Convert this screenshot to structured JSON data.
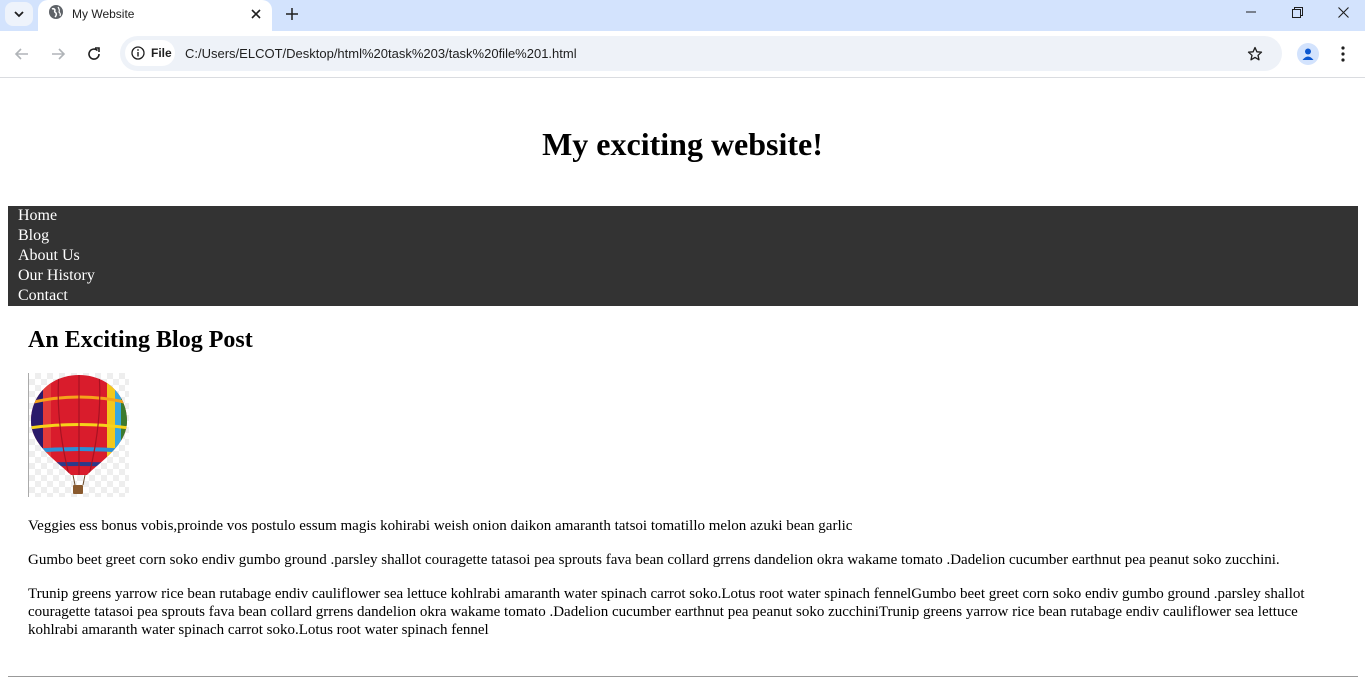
{
  "browser": {
    "tab_title": "My Website",
    "site_chip_label": "File",
    "url": "C:/Users/ELCOT/Desktop/html%20task%203/task%20file%201.html"
  },
  "page": {
    "site_title": "My exciting website!",
    "nav": [
      {
        "label": "Home"
      },
      {
        "label": "Blog"
      },
      {
        "label": "About Us"
      },
      {
        "label": "Our History"
      },
      {
        "label": "Contact"
      }
    ],
    "post_title": "An Exciting Blog Post",
    "paragraphs": [
      "Veggies ess bonus vobis,proinde vos postulo essum magis kohirabi weish onion daikon amaranth tatsoi tomatillo melon azuki bean garlic",
      "Gumbo beet greet corn soko endiv gumbo ground .parsley shallot couragette tatasoi pea sprouts fava bean collard grrens dandelion okra wakame tomato .Dadelion cucumber earthnut pea peanut soko zucchini.",
      "Trunip greens yarrow rice bean rutabage endiv cauliflower sea lettuce kohlrabi amaranth water spinach carrot soko.Lotus root water spinach fennelGumbo beet greet corn soko endiv gumbo ground .parsley shallot couragette tatasoi pea sprouts fava bean collard grrens dandelion okra wakame tomato .Dadelion cucumber earthnut pea peanut soko zucchiniTrunip greens yarrow rice bean rutabage endiv cauliflower sea lettuce kohlrabi amaranth water spinach carrot soko.Lotus root water spinach fennel"
    ]
  },
  "colors": {
    "tab_strip": "#d3e3fd",
    "nav_background": "#333333",
    "nav_text": "#ffffff"
  },
  "icons": {
    "tab_favicon": "globe-icon",
    "tab_close": "close-icon",
    "new_tab": "plus-icon",
    "back": "arrow-left-icon",
    "forward": "arrow-right-icon",
    "reload": "reload-icon",
    "site_info": "info-icon",
    "bookmark": "star-icon",
    "profile": "person-icon",
    "menu": "kebab-menu-icon",
    "post_image": "hot-air-balloon-image"
  }
}
